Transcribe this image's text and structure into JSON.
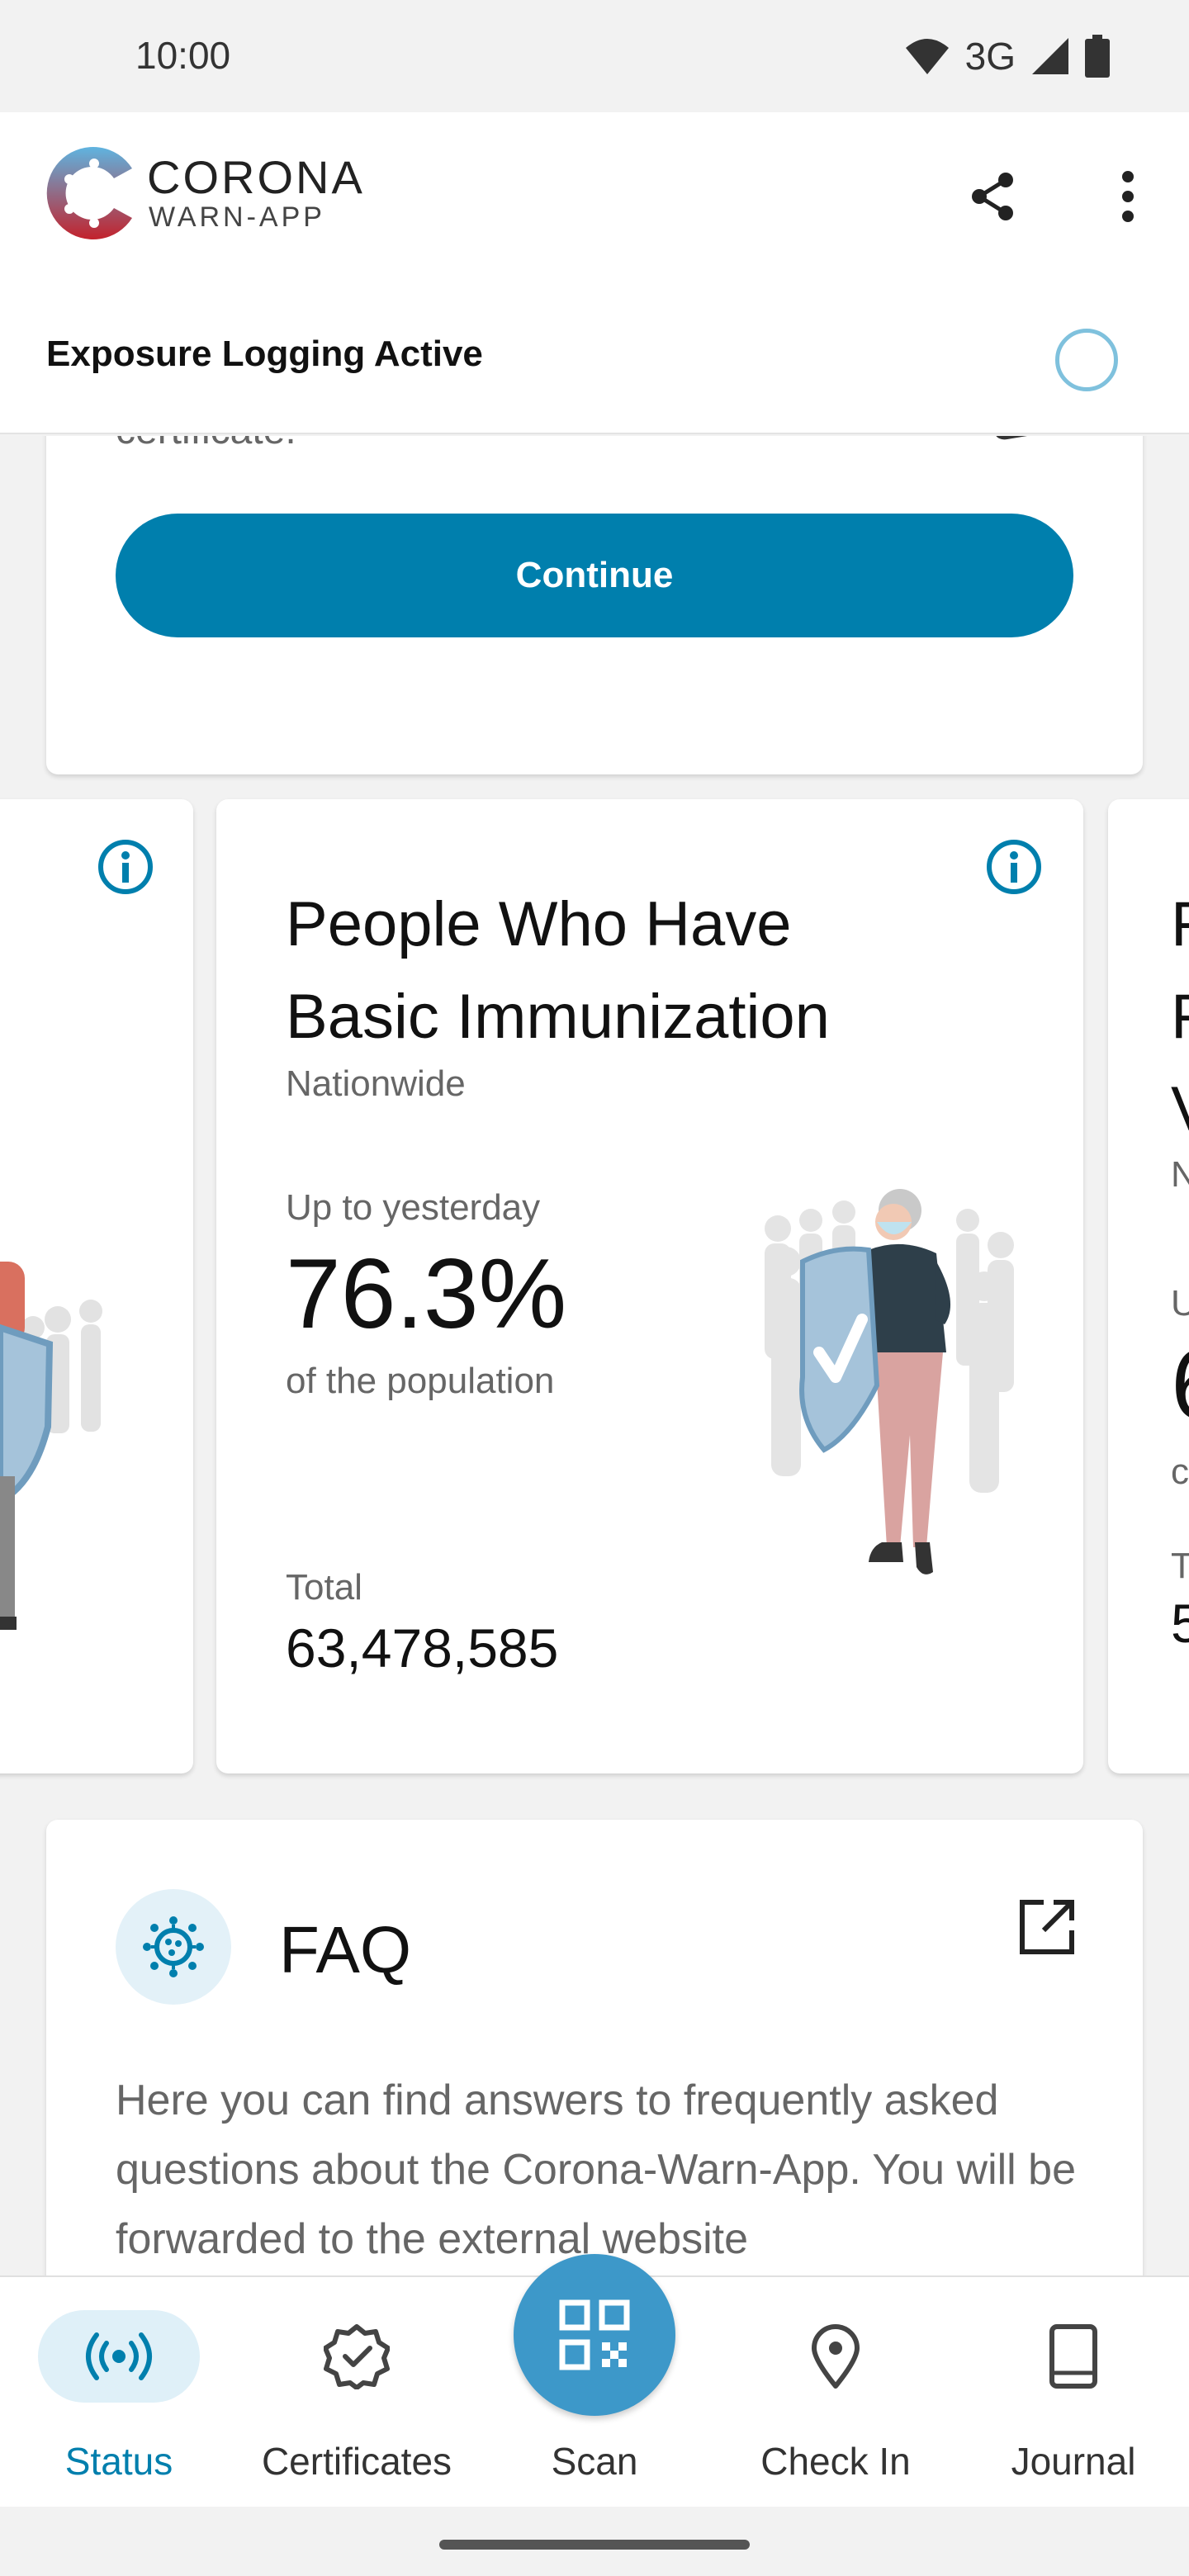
{
  "status_bar": {
    "time": "10:00",
    "network": "3G"
  },
  "header": {
    "brand_title": "CORONA",
    "brand_subtitle": "WARN-APP",
    "logging_status": "Exposure Logging Active"
  },
  "certificate_card": {
    "partial_text": "certificate.",
    "continue_label": "Continue"
  },
  "statistics": {
    "main": {
      "title": "People Who Have Basic Immunization",
      "region": "Nationwide",
      "period": "Up to yesterday",
      "value": "76.3%",
      "caption": "of the population",
      "total_label": "Total",
      "total_value": "63,478,585"
    },
    "right_peek": {
      "title_letters": [
        "F",
        "F",
        "V"
      ],
      "region_letter": "N",
      "period_letter": "U",
      "value_letter": "6",
      "caption_letter": "c",
      "total_label_letter": "T",
      "total_value_letter": "5"
    }
  },
  "faq": {
    "title": "FAQ",
    "description": "Here you can find answers to frequently asked questions about the Corona-Warn-App. You will be forwarded to the external website"
  },
  "bottom_nav": {
    "items": [
      {
        "label": "Status",
        "icon": "broadcast-icon",
        "active": true
      },
      {
        "label": "Certificates",
        "icon": "certificate-badge-icon"
      },
      {
        "label": "Scan",
        "icon": "qr-code-icon"
      },
      {
        "label": "Check In",
        "icon": "location-pin-icon"
      },
      {
        "label": "Journal",
        "icon": "book-icon"
      }
    ]
  },
  "colors": {
    "primary": "#007fad",
    "active_nav_bg": "#dff0f8",
    "scan_fab": "#3d98c9",
    "ring": "#7fc1dd"
  }
}
